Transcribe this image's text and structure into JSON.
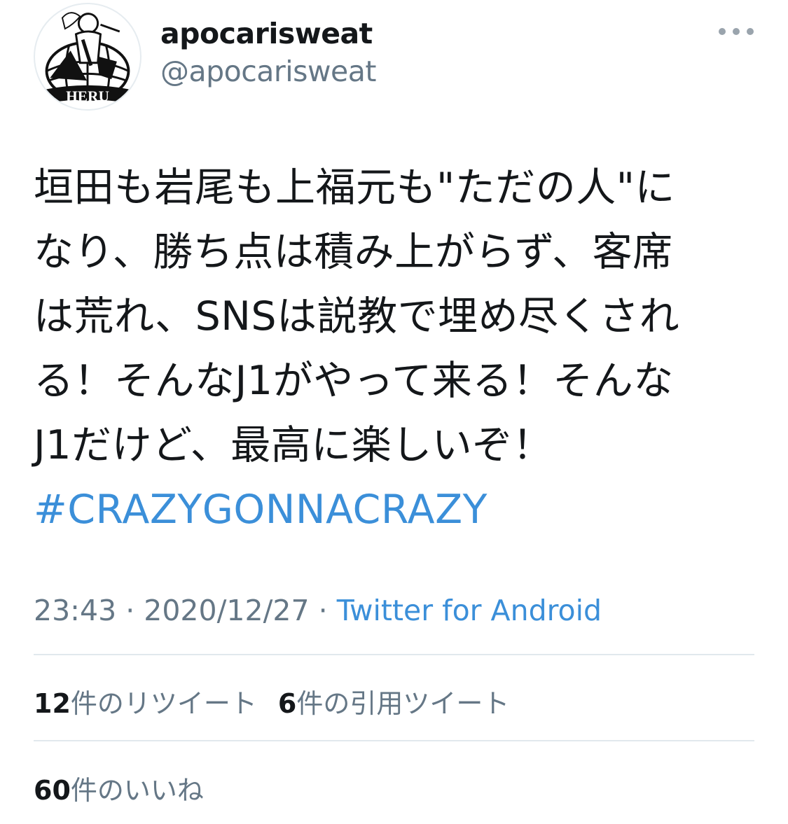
{
  "header": {
    "display_name": "apocarisweat",
    "handle": "@apocarisweat",
    "avatar_text": "HERU"
  },
  "tweet": {
    "lines": [
      "垣田も岩尾も上福元も\"ただの人\"に",
      "なり、勝ち点は積み上がらず、客席",
      "は荒れ、SNSは説教で埋め尽くされ",
      "る！そんなJ1がやって来る！そんな",
      "J1だけど、最高に楽しいぞ！"
    ],
    "hashtag": "#CRAZYGONNACRAZY"
  },
  "meta": {
    "time": "23:43",
    "separator": " · ",
    "date": "2020/12/27",
    "source": "Twitter for Android"
  },
  "stats": {
    "retweets_count": "12",
    "retweets_label": "件のリツイート",
    "quotes_count": "6",
    "quotes_label": "件の引用ツイート",
    "likes_count": "60",
    "likes_label": "件のいいね"
  },
  "colors": {
    "link": "#3b8fd9",
    "secondary": "#657786",
    "primary": "#14171a"
  }
}
